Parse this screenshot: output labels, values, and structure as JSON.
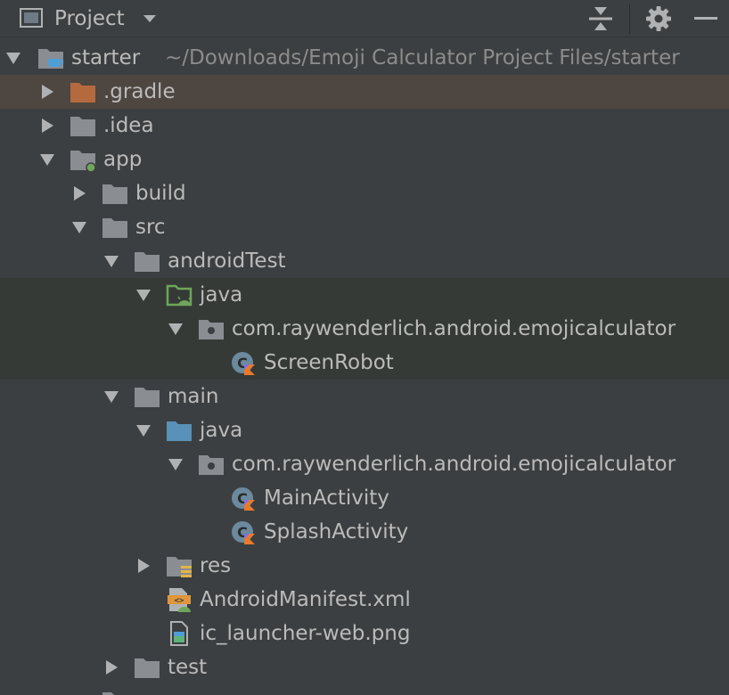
{
  "header": {
    "title": "Project"
  },
  "tree": {
    "starter": {
      "label": "starter",
      "path": "~/Downloads/Emoji Calculator Project Files/starter"
    },
    "gradle": {
      "label": ".gradle"
    },
    "idea": {
      "label": ".idea"
    },
    "app": {
      "label": "app"
    },
    "build": {
      "label": "build"
    },
    "src": {
      "label": "src"
    },
    "androidTest": {
      "label": "androidTest"
    },
    "androidTestJava": {
      "label": "java"
    },
    "androidTestPackage": {
      "label": "com.raywenderlich.android.emojicalculator"
    },
    "screenRobot": {
      "label": "ScreenRobot"
    },
    "main": {
      "label": "main"
    },
    "mainJava": {
      "label": "java"
    },
    "mainPackage": {
      "label": "com.raywenderlich.android.emojicalculator"
    },
    "mainActivity": {
      "label": "MainActivity"
    },
    "splashActivity": {
      "label": "SplashActivity"
    },
    "res": {
      "label": "res"
    },
    "manifest": {
      "label": "AndroidManifest.xml"
    },
    "launcherPng": {
      "label": "ic_launcher-web.png"
    },
    "test": {
      "label": "test"
    }
  },
  "colors": {
    "background": "#3c3f41",
    "folder": "#8a8d91",
    "selection_brown": "#4e4640",
    "selection_green": "#353a36",
    "gradle_folder": "#b56a3e",
    "java_source_folder": "#5991b8",
    "android_green": "#6fa65a"
  }
}
